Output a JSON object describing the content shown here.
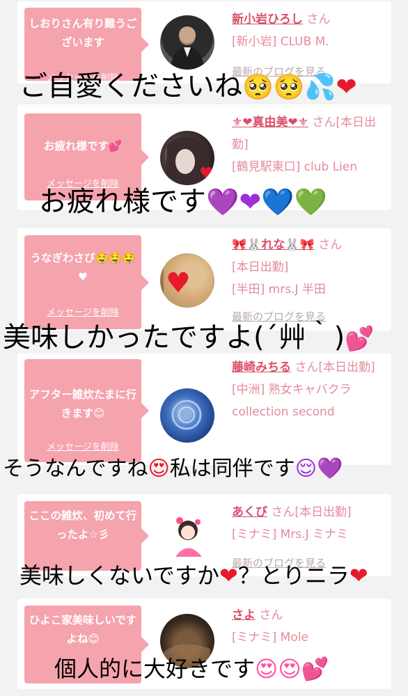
{
  "colors": {
    "bubble": "#f5a3ad",
    "name": "#d94f6a",
    "shop": "#e58a9a",
    "blog": "#b9a9ac",
    "background": "#f2f2f2"
  },
  "delete_label": "メッセージを削除",
  "blog_label": "最新のブログを見る",
  "entries": [
    {
      "message": "しおりさん有り難うございます",
      "name": "新小岩ひろし",
      "san": "さん",
      "shop": "[新小岩] CLUB M.",
      "avatar": "man-in-suit"
    },
    {
      "message": "お疲れ様です💕",
      "name": "⚜❤真由美❤⚜",
      "san": "さん",
      "status": "[本日出勤]",
      "shop": "[鶴見駅東口] club Lien",
      "avatar": "woman-with-heart"
    },
    {
      "message": "うなぎわさび🤤🤤🤤♥",
      "name": "🎀🐰れな🐰🎀",
      "san": "さん",
      "status": "[本日出勤]",
      "shop": "[半田] mrs.J 半田",
      "avatar": "woman-with-heart"
    },
    {
      "message": "アフター雑炊たまに行きます😊",
      "name": "藤崎みちる",
      "san": "さん",
      "status": "[本日出勤]",
      "shop": "[中洲] 熟女キャバクラ collection second",
      "avatar": "blue-rose"
    },
    {
      "message": "ここの雑炊、初めて行ったよ☆彡",
      "name": "あくび",
      "san": "さん",
      "status": "[本日出勤]",
      "shop": "[ミナミ] Mrs.J ミナミ",
      "avatar": "cartoon-girl"
    },
    {
      "message": "ひよこ家美味しいですよね😊",
      "name": "さよ",
      "san": "さん",
      "shop": "[ミナミ] Mole",
      "avatar": "dark-photo"
    }
  ],
  "overlays": {
    "o1": {
      "text": "ご自愛くださいね",
      "emoji": "🥺🥺💦❤"
    },
    "o2": {
      "text": "お疲れ様です",
      "emoji": "💜❤💙💚"
    },
    "o3": {
      "text": "美味しかったですよ(´艸｀)",
      "emoji": "💕"
    },
    "o4": {
      "text_a": "そうなんですね",
      "emoji_a": "😍",
      "text_b": "私は同伴です",
      "emoji_b": "😌💜"
    },
    "o5": {
      "text_a": "美味しくないですか",
      "emoji_a": "❤",
      "text_b": "？とりニラ",
      "emoji_b": "❤"
    },
    "o6": {
      "text": "個人的に大好きです",
      "emoji": "😍😍💕"
    }
  }
}
